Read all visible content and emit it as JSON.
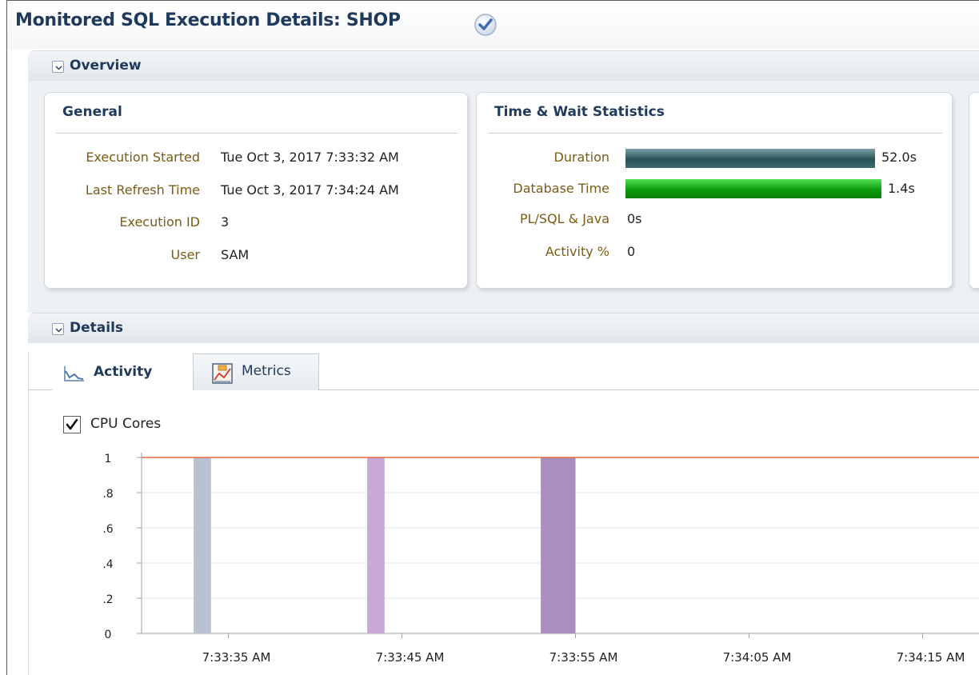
{
  "page": {
    "title": "Monitored SQL Execution Details: SHOP",
    "status_icon": "checkmark-icon"
  },
  "overview": {
    "label": "Overview",
    "general": {
      "title": "General",
      "rows": [
        {
          "label": "Execution Started",
          "value": "Tue Oct 3, 2017 7:33:32 AM"
        },
        {
          "label": "Last Refresh Time",
          "value": "Tue Oct 3, 2017 7:34:24 AM"
        },
        {
          "label": "Execution ID",
          "value": "3"
        },
        {
          "label": "User",
          "value": "SAM"
        }
      ]
    },
    "time_wait": {
      "title": "Time & Wait Statistics",
      "rows": [
        {
          "label": "Duration",
          "value": "52.0s",
          "seconds": 52.0,
          "color": "#2a5357"
        },
        {
          "label": "Database Time",
          "value": "1.4s",
          "seconds": 1.4,
          "color": "#0a9a0a"
        },
        {
          "label": "PL/SQL & Java",
          "value": "0s"
        },
        {
          "label": "Activity %",
          "value": "0"
        }
      ]
    }
  },
  "details": {
    "label": "Details",
    "tabs": [
      {
        "label": "Activity",
        "icon": "activity-chart-icon",
        "active": true
      },
      {
        "label": "Metrics",
        "icon": "metrics-chart-icon",
        "active": false
      }
    ],
    "cpu_cores_checkbox": {
      "label": "CPU Cores",
      "checked": true
    }
  },
  "chart_data": {
    "type": "bar",
    "title": "",
    "xlabel": "",
    "ylabel": "",
    "ylim": [
      0,
      1
    ],
    "yticks": [
      "0",
      ".2",
      ".4",
      ".6",
      ".8",
      "1"
    ],
    "xticks": [
      "7:33:35 AM",
      "7:33:45 AM",
      "7:33:55 AM",
      "7:34:05 AM",
      "7:34:15 AM"
    ],
    "xtick_seconds": [
      5,
      15,
      25,
      35,
      45
    ],
    "x_start_label": "7:33:30 AM",
    "cpu_cores_line": {
      "value": 1,
      "color": "#e8663d"
    },
    "grid": true,
    "bars": [
      {
        "start_seconds": 3.0,
        "end_seconds": 4.0,
        "value": 1,
        "color": "#b7c3d3"
      },
      {
        "start_seconds": 13.0,
        "end_seconds": 14.0,
        "value": 1,
        "color": "#c7a8d7"
      },
      {
        "start_seconds": 23.0,
        "end_seconds": 25.0,
        "value": 1,
        "color": "#a88fc0"
      }
    ]
  }
}
